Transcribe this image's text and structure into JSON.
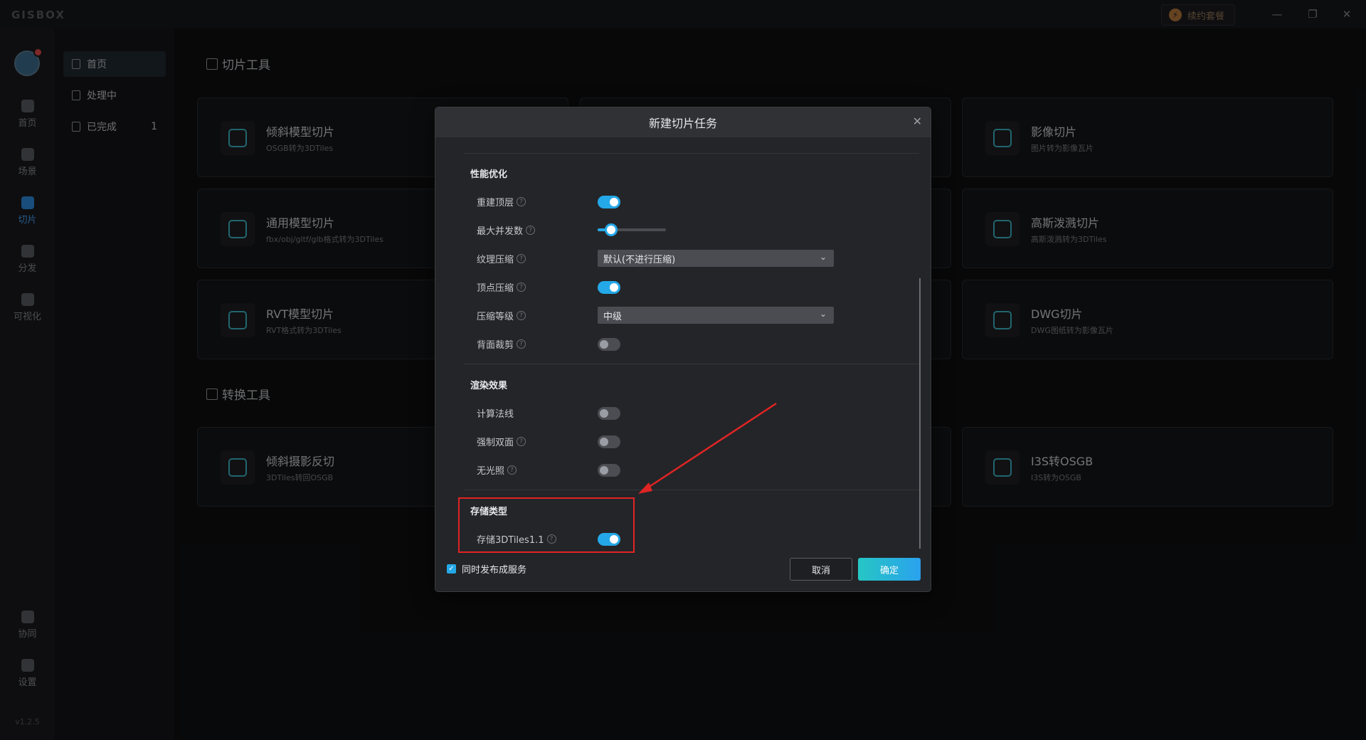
{
  "app": {
    "logo": "GISBOX",
    "promo": "续约套餐",
    "version": "v1.2.5"
  },
  "window": {
    "minimize": "—",
    "restore": "❐",
    "close": "✕"
  },
  "rail": [
    {
      "label": "首页"
    },
    {
      "label": "场景"
    },
    {
      "label": "切片"
    },
    {
      "label": "分发"
    },
    {
      "label": "可视化"
    },
    {
      "label": "协同"
    },
    {
      "label": "设置"
    }
  ],
  "subnav": [
    {
      "label": "首页",
      "count": ""
    },
    {
      "label": "处理中",
      "count": ""
    },
    {
      "label": "已完成",
      "count": "1"
    }
  ],
  "sections": {
    "slice_tools": "切片工具",
    "convert_tools": "转换工具"
  },
  "cards": [
    {
      "title": "倾斜模型切片",
      "subtitle": "OSGB转为3DTiles"
    },
    {
      "title": "影像切片",
      "subtitle": "图片转为影像瓦片"
    },
    {
      "title": "通用模型切片",
      "subtitle": "fbx/obj/gltf/glb格式转为3DTiles"
    },
    {
      "title": "高斯泼溅切片",
      "subtitle": "高斯泼溅转为3DTiles"
    },
    {
      "title": "RVT模型切片",
      "subtitle": "RVT格式转为3DTiles"
    },
    {
      "title": "DWG切片",
      "subtitle": "DWG图纸转为影像瓦片"
    },
    {
      "title": "倾斜摄影反切",
      "subtitle": "3DTiles转回OSGB"
    },
    {
      "title": "I3S转OSGB",
      "subtitle": "I3S转为OSGB"
    }
  ],
  "modal": {
    "title": "新建切片任务",
    "close": "✕",
    "groups": {
      "perf": "性能优化",
      "render": "渲染效果",
      "storage": "存储类型"
    },
    "rows": {
      "rebuild_top": "重建顶层",
      "max_concurrency": "最大并发数",
      "texture_compress": "纹理压缩",
      "vertex_compress": "顶点压缩",
      "compress_level": "压缩等级",
      "backface_cull": "背面裁剪",
      "compute_normals": "计算法线",
      "force_double_side": "强制双面",
      "no_lighting": "无光照",
      "store_3dtiles11": "存储3DTiles1.1"
    },
    "values": {
      "texture_compress": "默认(不进行压缩)",
      "compress_level": "中级",
      "max_concurrency_fraction": 0.2
    },
    "toggles": {
      "rebuild_top": true,
      "vertex_compress": true,
      "backface_cull": false,
      "compute_normals": false,
      "force_double_side": false,
      "no_lighting": false,
      "store_3dtiles11": true
    },
    "publish_service": "同时发布成服务",
    "publish_checked": true,
    "cancel": "取消",
    "ok": "确定"
  },
  "colors": {
    "accent": "#24a8e8",
    "annotation": "#e02424"
  }
}
